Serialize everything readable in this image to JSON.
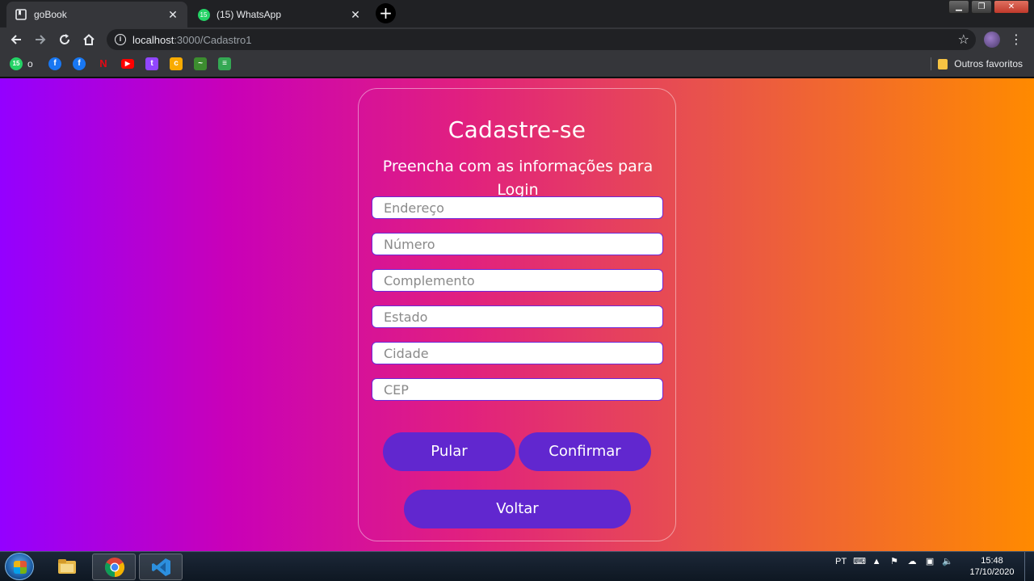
{
  "browser": {
    "tabs": [
      {
        "title": "goBook",
        "active": true
      },
      {
        "title": "(15) WhatsApp",
        "active": false,
        "badge": "15"
      }
    ],
    "new_tab_label": "+",
    "close_glyph": "✕",
    "url_host": "localhost",
    "url_path": ":3000/Cadastro1",
    "info_glyph": "i",
    "bookmarks": [
      {
        "icon": "whatsapp-icon",
        "text": "15",
        "color": "#25d366"
      },
      {
        "icon": "facebook-icon",
        "text": "f",
        "color": "#1877f2"
      },
      {
        "icon": "facebook-icon",
        "text": "f",
        "color": "#1877f2"
      },
      {
        "icon": "netflix-icon",
        "text": "N",
        "color": "#e50914"
      },
      {
        "icon": "youtube-icon",
        "text": "▶",
        "color": "#ff0000"
      },
      {
        "icon": "twitch-icon",
        "text": "t",
        "color": "#9146ff"
      },
      {
        "icon": "classroom-icon",
        "text": "c",
        "color": "#f9ab00"
      },
      {
        "icon": "app-icon",
        "text": "~",
        "color": "#3c8d2f"
      },
      {
        "icon": "app-icon-2",
        "text": "≡",
        "color": "#34a853"
      }
    ],
    "bookmark_label": "o",
    "other_bookmarks": "Outros favoritos"
  },
  "page": {
    "title": "Cadastre-se",
    "subtitle": "Preencha com as informações para Login",
    "fields": [
      {
        "placeholder": "Endereço"
      },
      {
        "placeholder": "Número"
      },
      {
        "placeholder": "Complemento"
      },
      {
        "placeholder": "Estado"
      },
      {
        "placeholder": "Cidade"
      },
      {
        "placeholder": "CEP"
      }
    ],
    "skip_label": "Pular",
    "confirm_label": "Confirmar",
    "back_label": "Voltar",
    "colors": {
      "button": "#6127cf",
      "gradient_start": "#9400ff",
      "gradient_end": "#ff8a00"
    }
  },
  "taskbar": {
    "language": "PT",
    "time": "15:48",
    "date": "17/10/2020",
    "apps": [
      "file-explorer-icon",
      "chrome-icon",
      "vscode-icon"
    ]
  }
}
